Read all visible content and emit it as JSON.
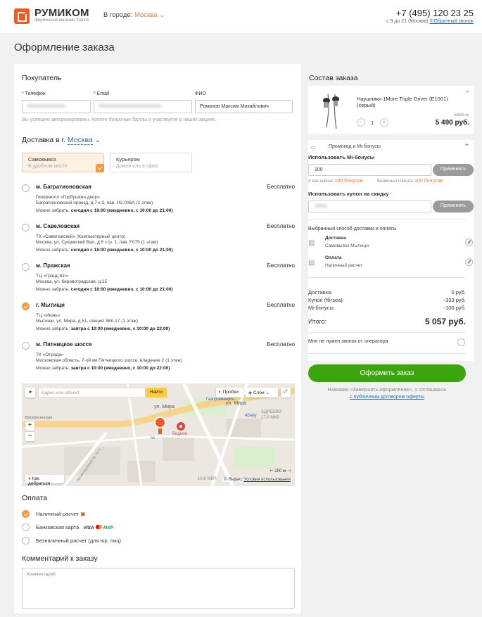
{
  "header": {
    "brand": "РУМИКОМ",
    "brand_sub": "фирменный магазин Xiaomi",
    "city_label": "В городе:",
    "city_value": "Москва",
    "phone": "+7 (495) 120 23 25",
    "hours": "с 9 до 21 (Москва)",
    "callback": "Обратный звонок"
  },
  "page_title": "Оформление заказа",
  "buyer": {
    "title": "Покупатель",
    "phone_label": "Телефон",
    "email_label": "Email",
    "name_label": "ФИО",
    "name_value": "Романов Максим Михайлович",
    "note": "Вы успешно авторизированы. Копите бонусные баллы и участвуйте в наших акциях."
  },
  "delivery": {
    "title_prefix": "Доставка в г.",
    "city": "Москва",
    "tabs": [
      {
        "title": "Самовывоз",
        "sub": "В удобном месте",
        "active": true
      },
      {
        "title": "Курьером",
        "sub": "Домой или в офис",
        "active": false
      }
    ],
    "points": [
      {
        "name": "м. Багратионовская",
        "place": "Гипермолл «Горбушкин двор»",
        "address": "Багратионовский проезд, д.7 к.3, пав. Н2-006А (2 этаж)",
        "when_label": "Можно забрать:",
        "when": "сегодня с 18:00 (ежедневно, с 10:00 до 21:00)",
        "price": "Бесплатно",
        "selected": false
      },
      {
        "name": "м. Савеловская",
        "place": "ТК «Савеловский» (Компьютерный центр)",
        "address": "Москва, ул. Сущевский Вал, д.5 стр. 1, пав. F075 (1 этаж)",
        "when_label": "Можно забрать:",
        "when": "сегодня с 18:00 (ежедневно, с 10:00 до 21:00)",
        "price": "Бесплатно",
        "selected": false
      },
      {
        "name": "м. Пражская",
        "place": "ТЦ «Гранд Юг»",
        "address": "Москва, ул. Кировоградская, д.15",
        "when_label": "Можно забрать:",
        "when": "сегодня с 18:00 (ежедневно, с 10:00 до 21:00)",
        "price": "Бесплатно",
        "selected": false
      },
      {
        "name": "г. Мытищи",
        "place": "ТЦ «Июнь»",
        "address": "Мытищи, ул. Мира, д.51, секция ЗКК-17 (1 этаж)",
        "when_label": "Можно забрать:",
        "when": "завтра с 10:00 (ежедневно, с 10:00 до 22:00)",
        "price": "Бесплатно",
        "selected": true
      },
      {
        "name": "м. Пятницкое шоссе",
        "place": "ТК «Отрада»",
        "address": "Московская область, 7-ой км Пятницкого шоссе, владение 2 (1 этаж)",
        "when_label": "Можно забрать:",
        "when": "завтра с 10:00 (ежедневно, с 10:00 до 22:00)",
        "price": "Бесплатно",
        "selected": false
      }
    ]
  },
  "map": {
    "search_placeholder": "Адрес или объект",
    "find": "Найти",
    "traffic": "Пробки",
    "layers": "Слои",
    "route": "Как добраться",
    "scale": "200 м",
    "copyright": "© Яндекс",
    "terms": "Условия использования",
    "labels": {
      "street1": "ул. Мира",
      "street2": "ул. Мира",
      "gazprom": "Газпромнефть",
      "ivi": "ivi",
      "vidnoe": "Видное",
      "adreevo": "АДРЕЕВО",
      "mkr": "17-й МКР.",
      "fourdaily": "4Daily",
      "voskres": "Воскресенская",
      "prosp": "Проектируемый пр. № 4",
      "mkr16": "16-й МКР."
    }
  },
  "payment": {
    "title": "Оплата",
    "options": [
      {
        "label": "Наличный расчет",
        "selected": true
      },
      {
        "label": "Банковская карта",
        "selected": false
      },
      {
        "label": "Безналичный расчет (для юр. лиц)",
        "selected": false
      }
    ],
    "visa": "VISA",
    "mir": "МИР"
  },
  "comment": {
    "title": "Комментарий к заказу",
    "placeholder": "Комментарий"
  },
  "order": {
    "title": "Состав заказа",
    "product_name": "Наушники 1More Triple Driver (E1001) (серый)",
    "old_price": "5990 р.",
    "price": "5 490 руб.",
    "qty": "1",
    "promo_title": "Промокод и Mi-бонусы",
    "use_bonus_label": "Использовать Mi-бонусы",
    "bonus_value": "100",
    "apply": "Применить",
    "bonus_have_prefix": "У вас сейчас",
    "bonus_have": "100 бонусов",
    "bonus_can_prefix": "Возможно списать",
    "bonus_can": "100 бонусов",
    "coupon_label": "Использовать купон на скидку",
    "method_title": "Выбранный способ доставки и оплаты",
    "delivery_label": "Доставка",
    "delivery_value": "Самовывоз Мытищи",
    "pay_label": "Оплата",
    "pay_value": "Наличный расчет",
    "sum_rows": [
      {
        "label": "Доставка:",
        "value": "0 руб."
      },
      {
        "label": "Купон (fбгsea):",
        "value": "-333 руб."
      },
      {
        "label": "Mi-бонусы:",
        "value": "-100 руб."
      }
    ],
    "total_label": "Итого:",
    "total": "5 057 руб.",
    "no_call": "Мне не нужен звонок от оператора",
    "submit": "Оформить заказ",
    "terms_text": "Нажимая «Завершить оформление», я соглашаюсь",
    "terms_link": "с публичным договором оферты"
  },
  "colors": {
    "accent": "#ee7a3b",
    "green": "#3aa50c",
    "link": "#2f6bb3"
  }
}
